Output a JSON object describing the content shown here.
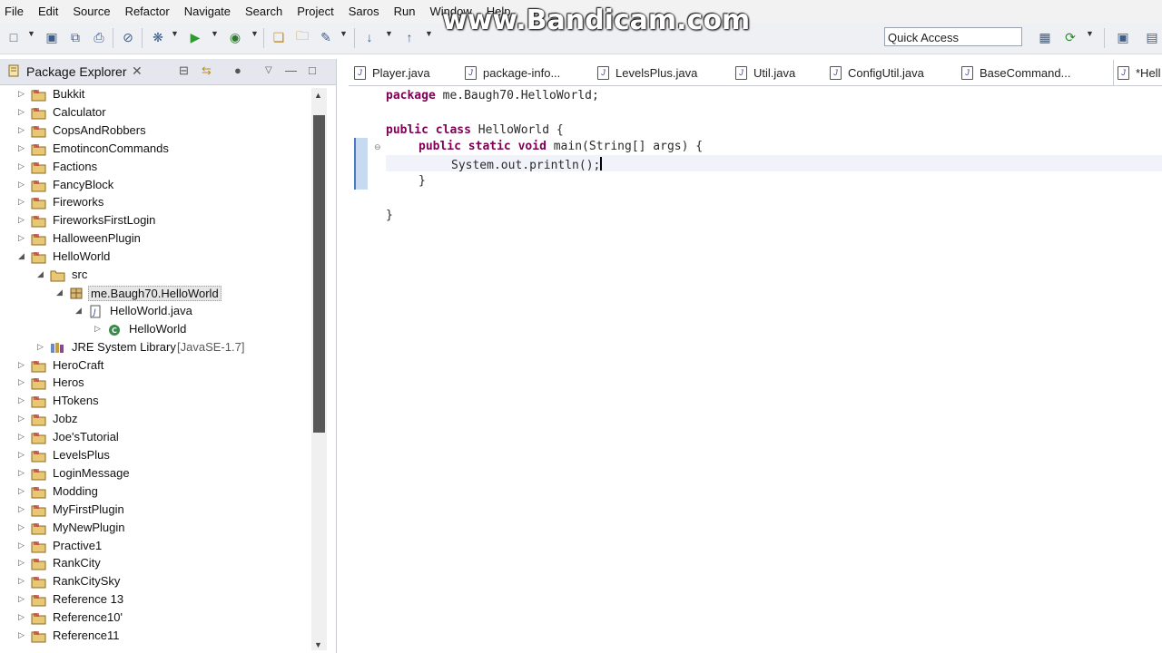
{
  "menu": [
    "File",
    "Edit",
    "Source",
    "Refactor",
    "Navigate",
    "Search",
    "Project",
    "Saros",
    "Run",
    "Window",
    "Help"
  ],
  "quick_access": "Quick Access",
  "watermark": "www.Bandicam.com",
  "explorer": {
    "title": "Package Explorer",
    "items": [
      {
        "label": "Bukkit"
      },
      {
        "label": "Calculator"
      },
      {
        "label": "CopsAndRobbers"
      },
      {
        "label": "EmotinconCommands"
      },
      {
        "label": "Factions"
      },
      {
        "label": "FancyBlock"
      },
      {
        "label": "Fireworks"
      },
      {
        "label": "FireworksFirstLogin"
      },
      {
        "label": "HalloweenPlugin"
      },
      {
        "label": "HelloWorld"
      },
      {
        "label": "src"
      },
      {
        "label": "me.Baugh70.HelloWorld"
      },
      {
        "label": "HelloWorld.java"
      },
      {
        "label": "HelloWorld"
      },
      {
        "label": "JRE System Library",
        "extra": "[JavaSE-1.7]"
      },
      {
        "label": "HeroCraft"
      },
      {
        "label": "Heros"
      },
      {
        "label": "HTokens"
      },
      {
        "label": "Jobz"
      },
      {
        "label": "Joe'sTutorial"
      },
      {
        "label": "LevelsPlus"
      },
      {
        "label": "LoginMessage"
      },
      {
        "label": "Modding"
      },
      {
        "label": "MyFirstPlugin"
      },
      {
        "label": "MyNewPlugin"
      },
      {
        "label": "Practive1"
      },
      {
        "label": "RankCity"
      },
      {
        "label": "RankCitySky"
      },
      {
        "label": "Reference 13"
      },
      {
        "label": "Reference10'"
      },
      {
        "label": "Reference11"
      }
    ]
  },
  "editor_tabs": [
    "Player.java",
    "package-info...",
    "LevelsPlus.java",
    "Util.java",
    "ConfigUtil.java",
    "BaseCommand...",
    "*Hell"
  ],
  "code": {
    "line1_kw": "package",
    "line1_rest": " me.Baugh70.HelloWorld;",
    "line2_kw1": "public",
    "line2_kw2": "class",
    "line2_rest": " HelloWorld {",
    "line3_kw1": "public",
    "line3_kw2": "static",
    "line3_kw3": "void",
    "line3_rest": " main(String[] args) {",
    "line4": "System.out.println();",
    "line5": "}",
    "line6": "}"
  }
}
